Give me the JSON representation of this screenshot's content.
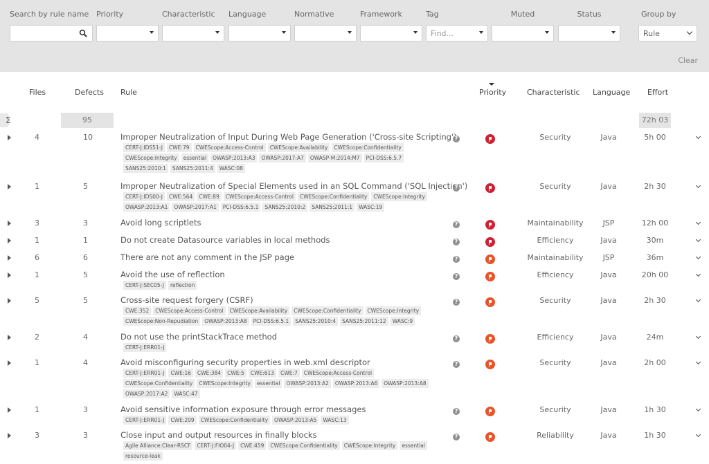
{
  "filters": {
    "search": {
      "label": "Search by rule name",
      "value": "",
      "placeholder": ""
    },
    "priority": {
      "label": "Priority",
      "value": ""
    },
    "characteristic": {
      "label": "Characteristic",
      "value": ""
    },
    "language": {
      "label": "Language",
      "value": ""
    },
    "normative": {
      "label": "Normative",
      "value": ""
    },
    "framework": {
      "label": "Framework",
      "value": ""
    },
    "tag": {
      "label": "Tag",
      "placeholder": "Find..."
    },
    "muted": {
      "label": "Muted",
      "value": ""
    },
    "status": {
      "label": "Status",
      "value": ""
    },
    "group_by": {
      "label": "Group by",
      "value": "Rule"
    },
    "clear_label": "Clear"
  },
  "columns": {
    "files": "Files",
    "defects": "Defects",
    "rule": "Rule",
    "priority": "Priority",
    "characteristic": "Characteristic",
    "language": "Language",
    "effort": "Effort"
  },
  "summary": {
    "sigma": "Σ",
    "defects": "95",
    "effort": "72h 03"
  },
  "colors": {
    "priority_critical": "#cc2233",
    "priority_high": "#e8542a"
  },
  "rows": [
    {
      "files": "4",
      "defects": "10",
      "title": "Improper Neutralization of Input During Web Page Generation ('Cross-site Scripting')",
      "tags": [
        "CERT-J:IDS51-J",
        "CWE:79",
        "CWEScope:Access-Control",
        "CWEScope:Availability",
        "CWEScope:Confidentiality",
        "CWEScope:Integrity",
        "essential",
        "OWASP:2013:A3",
        "OWASP:2017:A7",
        "OWASP-M:2014:M7",
        "PCI-DSS:6.5.7",
        "SANS25:2010:1",
        "SANS25:2011:4",
        "WASC:08"
      ],
      "priority": "critical",
      "characteristic": "Security",
      "language": "Java",
      "effort": "5h 00"
    },
    {
      "files": "1",
      "defects": "5",
      "title": "Improper Neutralization of Special Elements used in an SQL Command ('SQL Injection')",
      "tags": [
        "CERT-J:IDS00-J",
        "CWE:564",
        "CWE:89",
        "CWEScope:Access-Control",
        "CWEScope:Confidentiality",
        "CWEScope:Integrity",
        "OWASP:2013:A1",
        "OWASP:2017:A1",
        "PCI-DSS:6.5.1",
        "SANS25:2010:2",
        "SANS25:2011:1",
        "WASC:19"
      ],
      "priority": "critical",
      "characteristic": "Security",
      "language": "Java",
      "effort": "2h 30"
    },
    {
      "files": "3",
      "defects": "3",
      "title": "Avoid long scriptlets",
      "tags": [],
      "priority": "critical",
      "characteristic": "Maintainability",
      "language": "JSP",
      "effort": "12h 00"
    },
    {
      "files": "1",
      "defects": "1",
      "title": "Do not create Datasource variables in local methods",
      "tags": [],
      "priority": "critical",
      "characteristic": "Efficiency",
      "language": "Java",
      "effort": "30m"
    },
    {
      "files": "6",
      "defects": "6",
      "title": "There are not any comment in the JSP page",
      "tags": [],
      "priority": "high",
      "characteristic": "Maintainability",
      "language": "JSP",
      "effort": "36m"
    },
    {
      "files": "1",
      "defects": "5",
      "title": "Avoid the use of reflection",
      "tags": [
        "CERT-J:SEC05-J",
        "reflection"
      ],
      "priority": "high",
      "characteristic": "Efficiency",
      "language": "Java",
      "effort": "20h 00"
    },
    {
      "files": "5",
      "defects": "5",
      "title": "Cross-site request forgery (CSRF)",
      "tags": [
        "CWE:352",
        "CWEScope:Access-Control",
        "CWEScope:Availability",
        "CWEScope:Confidentiality",
        "CWEScope:Integrity",
        "CWEScope:Non-Repudiation",
        "OWASP:2013:A8",
        "PCI-DSS:6.5.1",
        "SANS25:2010:4",
        "SANS25:2011:12",
        "WASC:9"
      ],
      "priority": "high",
      "characteristic": "Security",
      "language": "Java",
      "effort": "2h 30"
    },
    {
      "files": "2",
      "defects": "4",
      "title": "Do not use the printStackTrace method",
      "tags": [
        "CERT-J:ERR01-J"
      ],
      "priority": "high",
      "characteristic": "Efficiency",
      "language": "Java",
      "effort": "24m"
    },
    {
      "files": "1",
      "defects": "4",
      "title": "Avoid misconfiguring security properties in web.xml descriptor",
      "tags": [
        "CERT-J:ERR01-J",
        "CWE:16",
        "CWE:384",
        "CWE:5",
        "CWE:613",
        "CWE:7",
        "CWEScope:Access-Control",
        "CWEScope:Confidentiality",
        "CWEScope:Integrity",
        "essential",
        "OWASP:2013:A2",
        "OWASP:2013:A6",
        "OWASP:2013:A8",
        "OWASP:2017:A2",
        "WASC:47"
      ],
      "priority": "high",
      "characteristic": "Security",
      "language": "Java",
      "effort": "2h 00"
    },
    {
      "files": "1",
      "defects": "3",
      "title": "Avoid sensitive information exposure through error messages",
      "tags": [
        "CERT-J:ERR01-J",
        "CWE:209",
        "CWEScope:Confidentiality",
        "OWASP:2013:A5",
        "WASC:13"
      ],
      "priority": "high",
      "characteristic": "Security",
      "language": "Java",
      "effort": "1h 30"
    },
    {
      "files": "3",
      "defects": "3",
      "title": "Close input and output resources in finally blocks",
      "tags": [
        "Agile Alliance:Clear-RSCF",
        "CERT-J:FIO04-J",
        "CWE:459",
        "CWEScope:Confidentiality",
        "CWEScope:Integrity",
        "essential",
        "resource-leak"
      ],
      "priority": "high",
      "characteristic": "Reliability",
      "language": "Java",
      "effort": "1h 30"
    }
  ]
}
